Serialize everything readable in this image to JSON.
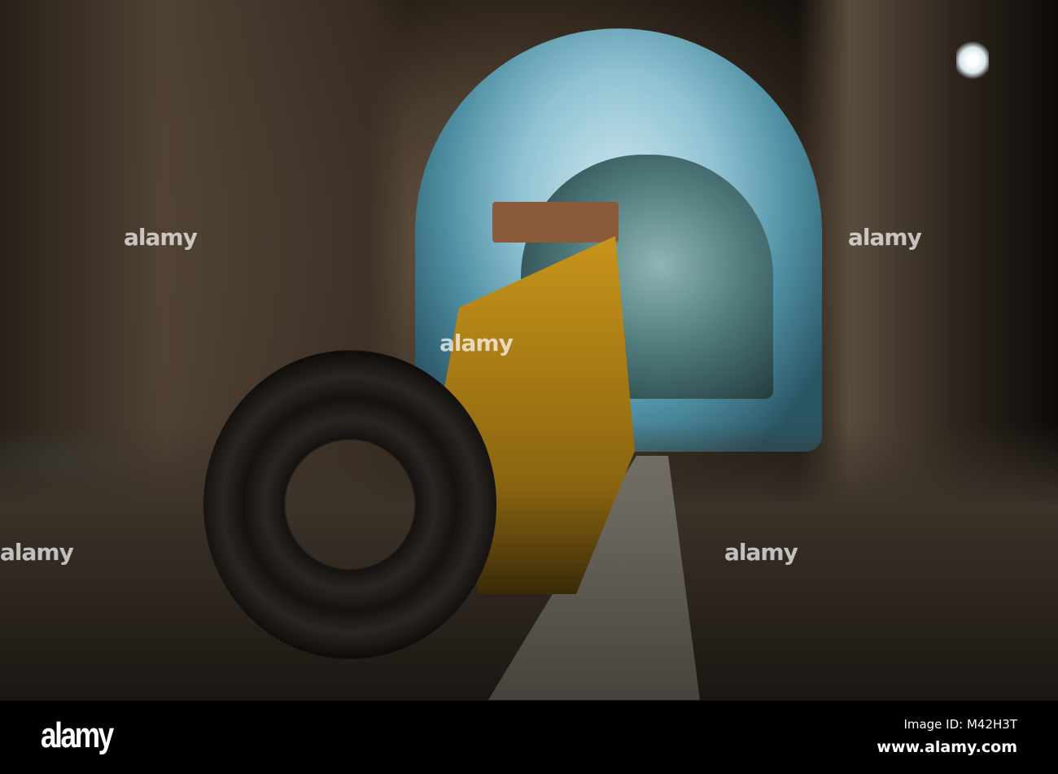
{
  "photo": {
    "subject": "underground mine tunnel with drilling rig"
  },
  "watermark": {
    "text": "alamy"
  },
  "footer": {
    "logo": "alamy",
    "image_id": "Image ID: M42H3T",
    "website": "www.alamy.com"
  }
}
